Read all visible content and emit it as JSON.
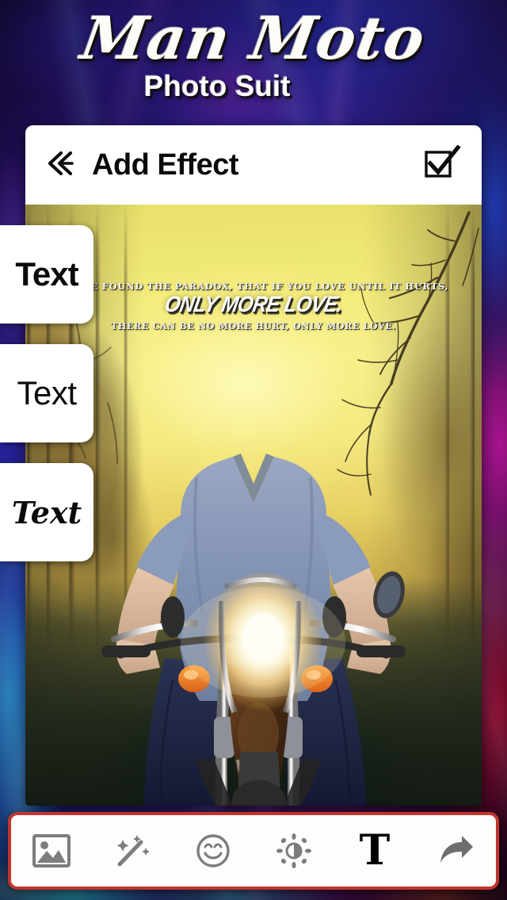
{
  "brand": {
    "title": "Man Moto",
    "subtitle": "Photo Suit"
  },
  "editor": {
    "header": {
      "back_icon": "double-chevron-left-icon",
      "title": "Add Effect",
      "done_icon": "checkbox-checked-icon"
    }
  },
  "font_rail": {
    "items": [
      {
        "label": "Text",
        "style": "bold-sans",
        "icon": "text-style-bold-icon"
      },
      {
        "label": "Text",
        "style": "regular-sans",
        "icon": "text-style-regular-icon"
      },
      {
        "label": "Text",
        "style": "script",
        "icon": "text-style-script-icon"
      }
    ]
  },
  "photo": {
    "quote": {
      "line1": "I HAVE FOUND THE PARADOX, THAT IF YOU LOVE UNTIL IT HURTS,",
      "line2": "ONLY MORE LOVE.",
      "line3": "THERE CAN BE NO MORE HURT, ONLY MORE LOVE."
    },
    "scene": "man on motorcycle on tree-lined road at sunset"
  },
  "toolbar": {
    "items": [
      {
        "name": "gallery",
        "icon": "image-icon",
        "label": "Gallery"
      },
      {
        "name": "effects",
        "icon": "magic-wand-icon",
        "label": "Effects"
      },
      {
        "name": "stickers",
        "icon": "smiley-icon",
        "label": "Stickers"
      },
      {
        "name": "brightness",
        "icon": "brightness-icon",
        "label": "Brightness"
      },
      {
        "name": "text",
        "icon": "text-T-icon",
        "label": "T"
      },
      {
        "name": "share",
        "icon": "share-arrow-icon",
        "label": "Share"
      }
    ]
  },
  "colors": {
    "toolbar_border": "#c0352f",
    "card_background": "#ffffff",
    "header_text": "#0b0b0b",
    "icon_grey": "#7d7d7d",
    "sky_yellow": "#f2ea78"
  }
}
